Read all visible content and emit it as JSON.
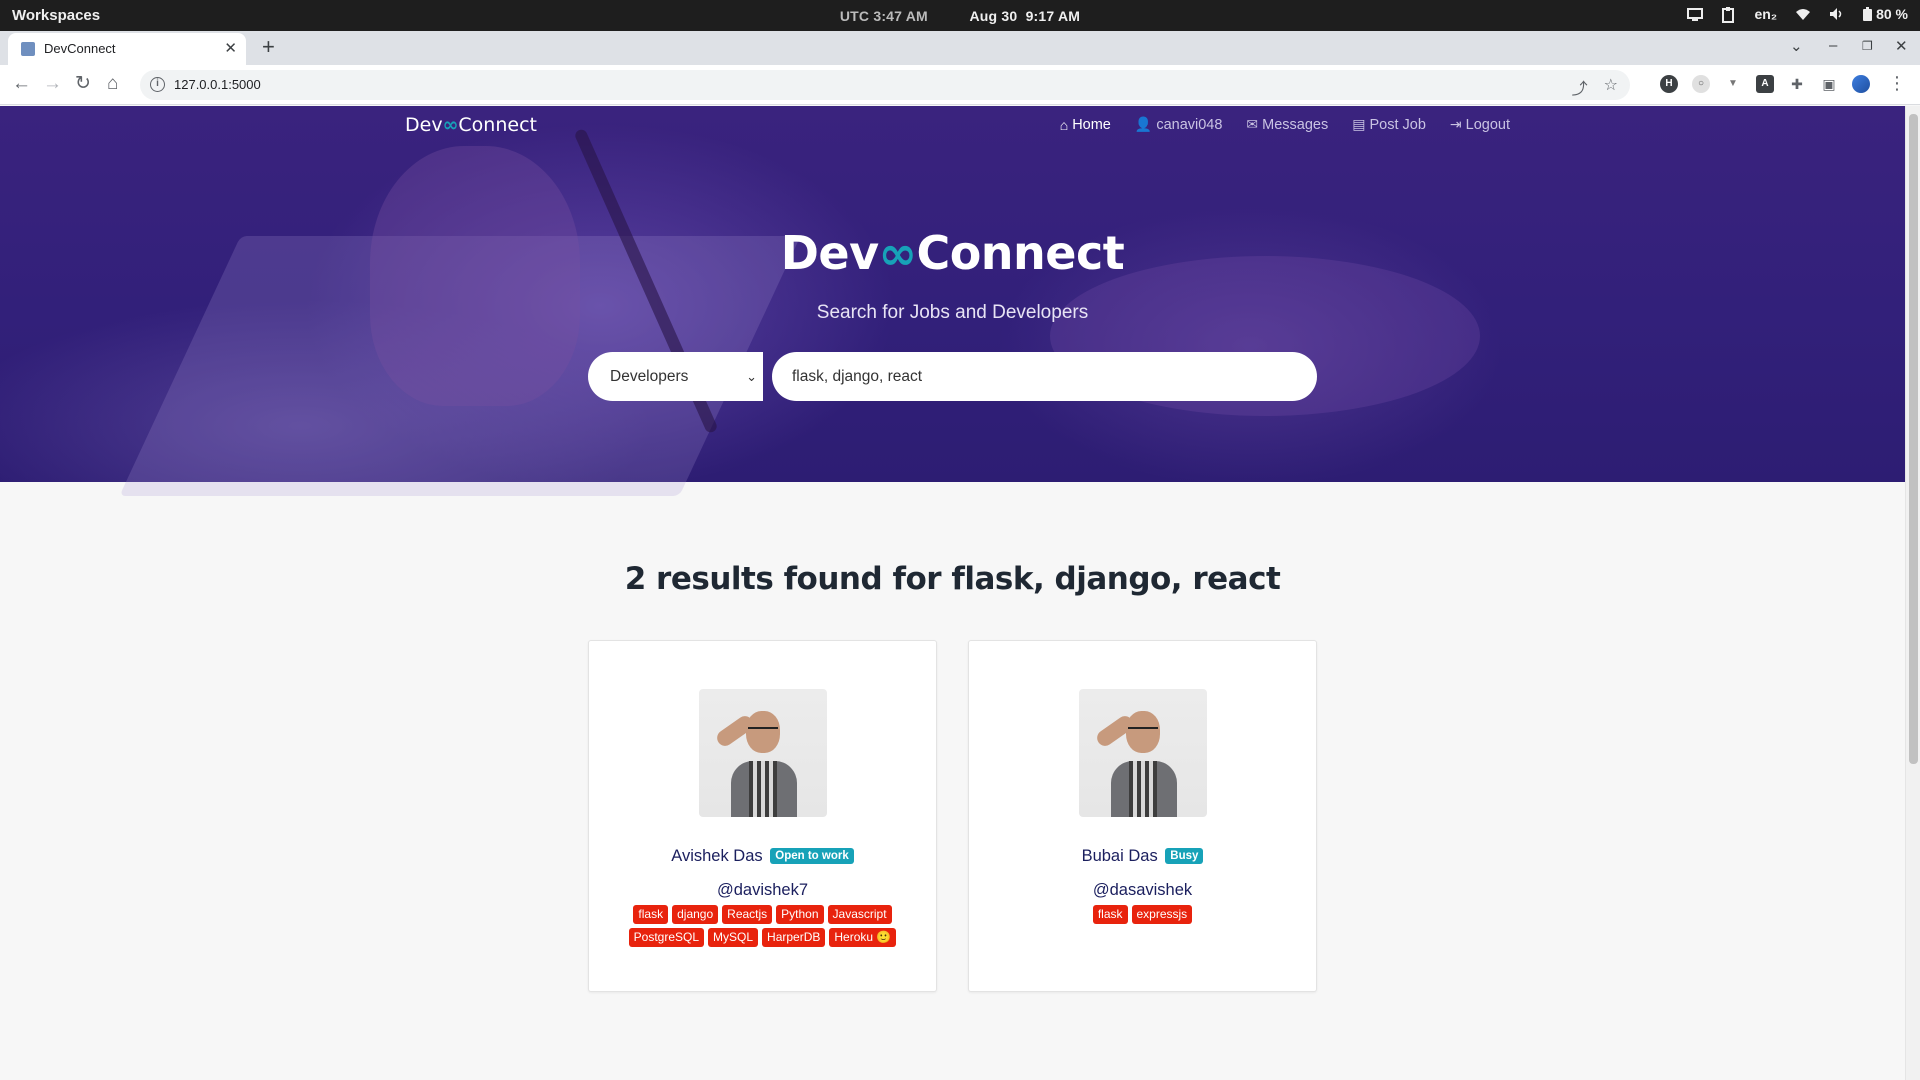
{
  "os": {
    "workspaces": "Workspaces",
    "utc_label": "UTC",
    "utc_time": "3:47 AM",
    "date": "Aug 30",
    "local_time": "9:17 AM",
    "lang": "en₂",
    "battery": "80 %"
  },
  "browser": {
    "tab_title": "DevConnect",
    "url": "127.0.0.1:5000"
  },
  "site": {
    "brand_left": "Dev",
    "brand_link": "🔗",
    "brand_right": "Connect",
    "nav": [
      {
        "label": "Home",
        "icon": "home-icon"
      },
      {
        "label": "canavi048",
        "icon": "user-icon"
      },
      {
        "label": "Messages",
        "icon": "envelope-icon"
      },
      {
        "label": "Post Job",
        "icon": "briefcase-icon"
      },
      {
        "label": "Logout",
        "icon": "sign-out-icon"
      }
    ]
  },
  "hero": {
    "title_left": "Dev",
    "title_right": "Connect",
    "subtitle": "Search for Jobs and Developers",
    "search_type": "Developers",
    "search_query": "flask, django, react"
  },
  "results": {
    "title": "2 results found for flask, django, react",
    "cards": [
      {
        "name": "Avishek Das",
        "status": "Open to work",
        "handle": "@davishek7",
        "tags": [
          "flask",
          "django",
          "Reactjs",
          "Python",
          "Javascript",
          "PostgreSQL",
          "MySQL",
          "HarperDB",
          "Heroku 🙂"
        ]
      },
      {
        "name": "Bubai Das",
        "status": "Busy",
        "handle": "@dasavishek",
        "tags": [
          "flask",
          "expressjs"
        ]
      }
    ]
  },
  "colors": {
    "hero_bg": "#32207a",
    "accent_link": "#17a2b8",
    "tag_red": "#e8230d",
    "badge_teal": "#17a2b8"
  }
}
